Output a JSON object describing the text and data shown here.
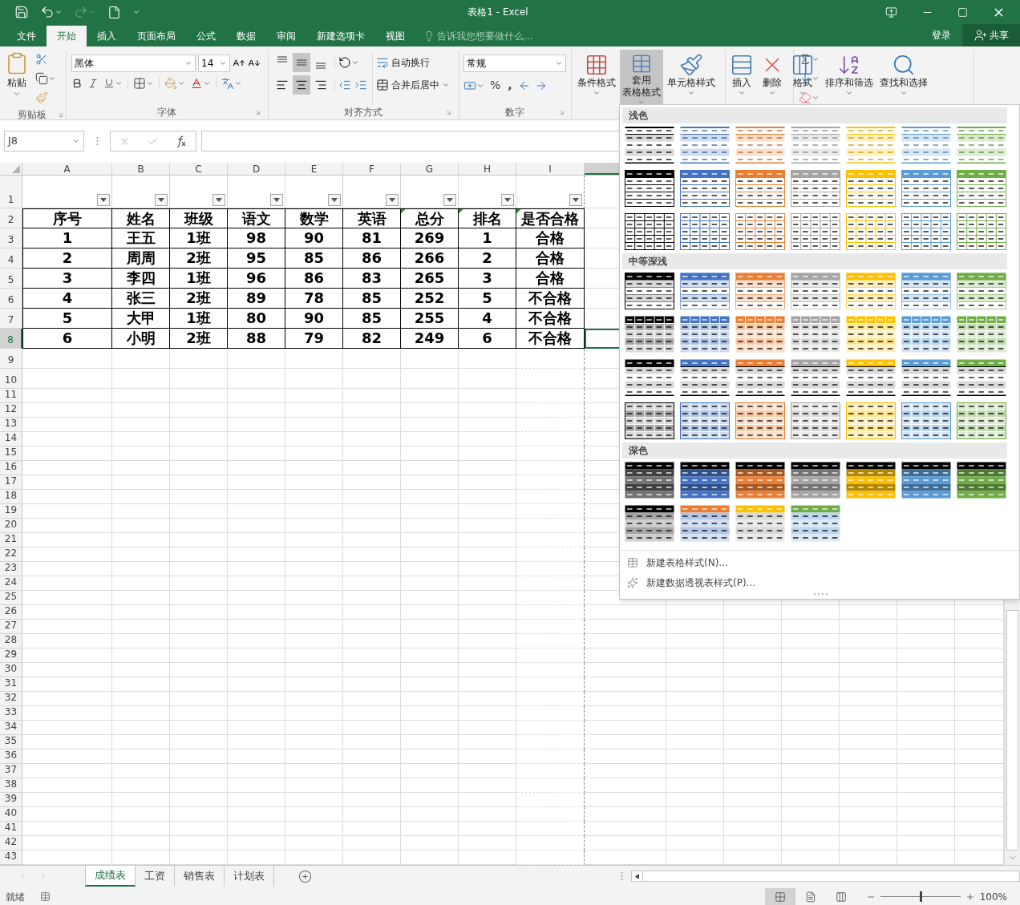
{
  "window": {
    "title": "表格1 - Excel",
    "redo_disabled": true
  },
  "menu": {
    "tabs": [
      {
        "label": "文件",
        "selected": false
      },
      {
        "label": "开始",
        "selected": true
      },
      {
        "label": "插入",
        "selected": false
      },
      {
        "label": "页面布局",
        "selected": false
      },
      {
        "label": "公式",
        "selected": false
      },
      {
        "label": "数据",
        "selected": false
      },
      {
        "label": "审阅",
        "selected": false
      },
      {
        "label": "新建选项卡",
        "selected": false
      },
      {
        "label": "视图",
        "selected": false
      }
    ],
    "tell_me": {
      "placeholder": "告诉我您想要做什么..."
    },
    "sign_in": "登录",
    "share": "共享"
  },
  "ribbon": {
    "clipboard": {
      "paste": "粘贴",
      "label": "剪贴板"
    },
    "font": {
      "name": "黑体",
      "size": "14",
      "label": "字体"
    },
    "alignment": {
      "vertical": [
        {
          "selected": false
        },
        {
          "selected": true
        },
        {
          "selected": false
        }
      ],
      "horizontal": [
        {
          "selected": false
        },
        {
          "selected": true
        },
        {
          "selected": false
        }
      ],
      "wrap": "自动换行",
      "merge": "合并后居中",
      "label": "对齐方式"
    },
    "number": {
      "format": "常规",
      "percent": "%",
      "comma": ",",
      "label": "数字"
    },
    "styles": [
      {
        "lines": [
          "条件格式"
        ],
        "kind": "conditional",
        "selected": false
      },
      {
        "lines": [
          "套用",
          "表格格式"
        ],
        "kind": "table",
        "selected": true
      },
      {
        "lines": [
          "单元格样式"
        ],
        "kind": "cell",
        "selected": false
      }
    ],
    "cells": [
      {
        "lines": [
          "插入"
        ],
        "kind": "insert"
      },
      {
        "lines": [
          "删除"
        ],
        "kind": "delete"
      },
      {
        "lines": [
          "格式"
        ],
        "kind": "format"
      }
    ],
    "editing": [
      {
        "lines": [
          "排序和筛选"
        ],
        "kind": "sort"
      },
      {
        "lines": [
          "查找和选择"
        ],
        "kind": "find"
      }
    ]
  },
  "formula_bar": {
    "name_box": "J8"
  },
  "sheet": {
    "columns": [
      {
        "label": "A",
        "selected": false
      },
      {
        "label": "B",
        "selected": false
      },
      {
        "label": "C",
        "selected": false
      },
      {
        "label": "D",
        "selected": false
      },
      {
        "label": "E",
        "selected": false
      },
      {
        "label": "F",
        "selected": false
      },
      {
        "label": "G",
        "selected": false
      },
      {
        "label": "H",
        "selected": false
      },
      {
        "label": "I",
        "selected": false
      }
    ],
    "active_column": {
      "selected": true
    },
    "row_numbers": [
      {
        "label": "1",
        "selected": false
      },
      {
        "label": "2",
        "selected": false
      },
      {
        "label": "3",
        "selected": false
      },
      {
        "label": "4",
        "selected": false
      },
      {
        "label": "5",
        "selected": false
      },
      {
        "label": "6",
        "selected": false
      },
      {
        "label": "7",
        "selected": false
      },
      {
        "label": "8",
        "selected": true
      },
      {
        "label": "9",
        "selected": false
      },
      {
        "label": "10",
        "selected": false
      },
      {
        "label": "11",
        "selected": false
      },
      {
        "label": "12",
        "selected": false
      },
      {
        "label": "13",
        "selected": false
      },
      {
        "label": "14",
        "selected": false
      },
      {
        "label": "15",
        "selected": false
      },
      {
        "label": "16",
        "selected": false
      },
      {
        "label": "17",
        "selected": false
      },
      {
        "label": "18",
        "selected": false
      },
      {
        "label": "19",
        "selected": false
      },
      {
        "label": "20",
        "selected": false
      },
      {
        "label": "21",
        "selected": false
      },
      {
        "label": "22",
        "selected": false
      },
      {
        "label": "23",
        "selected": false
      },
      {
        "label": "24",
        "selected": false
      },
      {
        "label": "25",
        "selected": false
      },
      {
        "label": "26",
        "selected": false
      },
      {
        "label": "27",
        "selected": false
      },
      {
        "label": "28",
        "selected": false
      },
      {
        "label": "29",
        "selected": false
      },
      {
        "label": "30",
        "selected": false
      },
      {
        "label": "31",
        "selected": false
      },
      {
        "label": "32",
        "selected": false
      },
      {
        "label": "33",
        "selected": false
      },
      {
        "label": "34",
        "selected": false
      },
      {
        "label": "35",
        "selected": false
      },
      {
        "label": "36",
        "selected": false
      },
      {
        "label": "37",
        "selected": false
      },
      {
        "label": "38",
        "selected": false
      },
      {
        "label": "39",
        "selected": false
      },
      {
        "label": "40",
        "selected": false
      },
      {
        "label": "41",
        "selected": false
      },
      {
        "label": "42",
        "selected": false
      },
      {
        "label": "43",
        "selected": false
      }
    ],
    "header": [
      {
        "text": "序号",
        "flagged": false
      },
      {
        "text": "姓名",
        "flagged": false
      },
      {
        "text": "班级",
        "flagged": false
      },
      {
        "text": "语文",
        "flagged": false
      },
      {
        "text": "数学",
        "flagged": false
      },
      {
        "text": "英语",
        "flagged": false
      },
      {
        "text": "总分",
        "flagged": true
      },
      {
        "text": "排名",
        "flagged": true
      },
      {
        "text": "是否合格",
        "flagged": true
      }
    ],
    "rows": [
      [
        "1",
        "王五",
        "1班",
        "98",
        "90",
        "81",
        "269",
        "1",
        "合格"
      ],
      [
        "2",
        "周周",
        "2班",
        "95",
        "85",
        "86",
        "266",
        "2",
        "合格"
      ],
      [
        "3",
        "李四",
        "1班",
        "96",
        "86",
        "83",
        "265",
        "3",
        "合格"
      ],
      [
        "4",
        "张三",
        "2班",
        "89",
        "78",
        "85",
        "252",
        "5",
        "不合格"
      ],
      [
        "5",
        "大甲",
        "1班",
        "80",
        "90",
        "85",
        "255",
        "4",
        "不合格"
      ],
      [
        "6",
        "小明",
        "2班",
        "88",
        "79",
        "82",
        "249",
        "6",
        "不合格"
      ]
    ]
  },
  "gallery": {
    "sections": [
      {
        "title": "浅色",
        "rows": [
          {
            "kind": "light-banded",
            "styles": [
              {
                "color": "#000000"
              },
              {
                "color": "#4472c4"
              },
              {
                "color": "#ed7d31"
              },
              {
                "color": "#a5a5a5"
              },
              {
                "color": "#ffc000"
              },
              {
                "color": "#5b9bd5"
              },
              {
                "color": "#70ad47"
              }
            ]
          },
          {
            "kind": "light-header",
            "styles": [
              {
                "color": "#000000"
              },
              {
                "color": "#4472c4"
              },
              {
                "color": "#ed7d31"
              },
              {
                "color": "#a5a5a5"
              },
              {
                "color": "#ffc000"
              },
              {
                "color": "#5b9bd5"
              },
              {
                "color": "#70ad47"
              }
            ]
          },
          {
            "kind": "light-grid",
            "styles": [
              {
                "color": "#000000"
              },
              {
                "color": "#4472c4"
              },
              {
                "color": "#ed7d31"
              },
              {
                "color": "#a5a5a5"
              },
              {
                "color": "#ffc000"
              },
              {
                "color": "#5b9bd5"
              },
              {
                "color": "#70ad47"
              }
            ]
          }
        ]
      },
      {
        "title": "中等深浅",
        "rows": [
          {
            "kind": "medium-header",
            "styles": [
              {
                "color": "#000000"
              },
              {
                "color": "#4472c4"
              },
              {
                "color": "#ed7d31"
              },
              {
                "color": "#a5a5a5"
              },
              {
                "color": "#ffc000"
              },
              {
                "color": "#5b9bd5"
              },
              {
                "color": "#70ad47"
              }
            ]
          },
          {
            "kind": "medium-grid",
            "styles": [
              {
                "color": "#000000"
              },
              {
                "color": "#4472c4"
              },
              {
                "color": "#ed7d31"
              },
              {
                "color": "#a5a5a5"
              },
              {
                "color": "#ffc000"
              },
              {
                "color": "#5b9bd5"
              },
              {
                "color": "#70ad47"
              }
            ]
          },
          {
            "kind": "medium-banded",
            "styles": [
              {
                "color": "#000000"
              },
              {
                "color": "#4472c4"
              },
              {
                "color": "#ed7d31"
              },
              {
                "color": "#a5a5a5"
              },
              {
                "color": "#ffc000"
              },
              {
                "color": "#5b9bd5"
              },
              {
                "color": "#70ad47"
              }
            ]
          },
          {
            "kind": "medium-fill",
            "styles": [
              {
                "color": "#000000"
              },
              {
                "color": "#4472c4"
              },
              {
                "color": "#ed7d31"
              },
              {
                "color": "#a5a5a5"
              },
              {
                "color": "#ffc000"
              },
              {
                "color": "#5b9bd5"
              },
              {
                "color": "#70ad47"
              }
            ]
          }
        ]
      },
      {
        "title": "深色",
        "rows": [
          {
            "kind": "dark",
            "styles": [
              {
                "color": "#000000"
              },
              {
                "color": "#4472c4"
              },
              {
                "color": "#ed7d31"
              },
              {
                "color": "#a5a5a5"
              },
              {
                "color": "#ffc000"
              },
              {
                "color": "#5b9bd5"
              },
              {
                "color": "#70ad47"
              }
            ]
          },
          {
            "kind": "dark-accent",
            "styles": [
              {
                "color": "#000000",
                "band": {
                  "color": "#a6a6a6"
                }
              },
              {
                "color": "#ed7d31",
                "band": {
                  "color": "#b4c6e7"
                }
              },
              {
                "color": "#ffc000",
                "band": {
                  "color": "#d9d9d9"
                }
              },
              {
                "color": "#70ad47",
                "band": {
                  "color": "#bdd7ee"
                }
              }
            ]
          }
        ]
      }
    ],
    "footer": [
      {
        "label": "新建表格样式(N)...",
        "kind": "table"
      },
      {
        "label": "新建数据透视表样式(P)...",
        "kind": "pivot"
      }
    ]
  },
  "sheet_tabs": [
    {
      "label": "成绩表",
      "selected": true
    },
    {
      "label": "工资",
      "selected": false
    },
    {
      "label": "销售表",
      "selected": false
    },
    {
      "label": "计划表",
      "selected": false
    }
  ],
  "status_bar": {
    "status": "就绪",
    "views": [
      {
        "kind": "normal",
        "selected": true
      },
      {
        "kind": "page_layout",
        "selected": false
      },
      {
        "kind": "page_break",
        "selected": false
      }
    ],
    "zoom_slider": {
      "level": 0.5
    },
    "zoom": "100%"
  }
}
